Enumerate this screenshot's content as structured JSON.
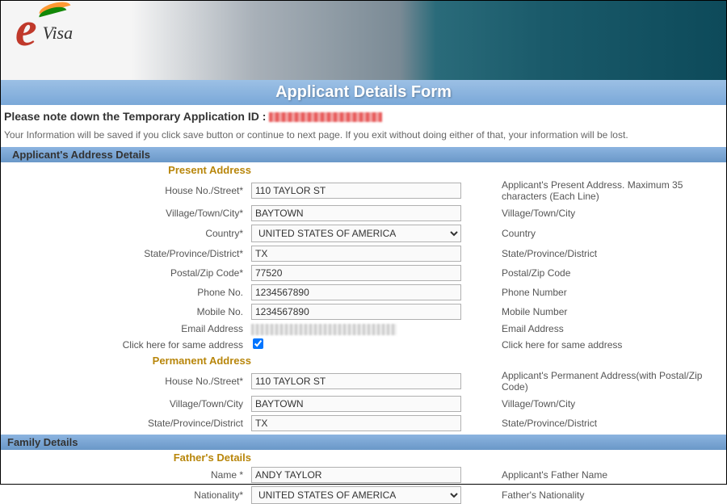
{
  "logo": {
    "e": "e",
    "visa": "Visa"
  },
  "title": "Applicant Details Form",
  "tempIdLabel": "Please note down the Temporary Application ID :",
  "infoText": "Your Information will be saved if you click save button or continue to next page. If you exit without doing either of that, your information will be lost.",
  "sections": {
    "address": "Applicant's Address Details",
    "family": "Family Details"
  },
  "subsections": {
    "present": "Present Address",
    "permanent": "Permanent Address",
    "father": "Father's Details"
  },
  "present": {
    "houseLabel": "House No./Street*",
    "houseValue": "110 TAYLOR ST",
    "houseHelp": "Applicant's Present Address. Maximum 35 characters (Each Line)",
    "cityLabel": "Village/Town/City*",
    "cityValue": "BAYTOWN",
    "cityHelp": "Village/Town/City",
    "countryLabel": "Country*",
    "countryValue": "UNITED STATES OF AMERICA",
    "countryHelp": "Country",
    "stateLabel": "State/Province/District*",
    "stateValue": "TX",
    "stateHelp": "State/Province/District",
    "postalLabel": "Postal/Zip Code*",
    "postalValue": "77520",
    "postalHelp": "Postal/Zip Code",
    "phoneLabel": "Phone No.",
    "phoneValue": "1234567890",
    "phoneHelp": "Phone Number",
    "mobileLabel": "Mobile No.",
    "mobileValue": "1234567890",
    "mobileHelp": "Mobile Number",
    "emailLabel": "Email Address",
    "emailHelp": "Email Address",
    "sameLabel": "Click here for same address",
    "sameHelp": "Click here for same address"
  },
  "permanent": {
    "houseLabel": "House No./Street*",
    "houseValue": "110 TAYLOR ST",
    "houseHelp": "Applicant's Permanent Address(with Postal/Zip Code)",
    "cityLabel": "Village/Town/City",
    "cityValue": "BAYTOWN",
    "cityHelp": "Village/Town/City",
    "stateLabel": "State/Province/District",
    "stateValue": "TX",
    "stateHelp": "State/Province/District"
  },
  "father": {
    "nameLabel": "Name *",
    "nameValue": "ANDY TAYLOR",
    "nameHelp": "Applicant's Father Name",
    "nationalityLabel": "Nationality*",
    "nationalityValue": "UNITED STATES OF AMERICA",
    "nationalityHelp": "Father's Nationality"
  }
}
